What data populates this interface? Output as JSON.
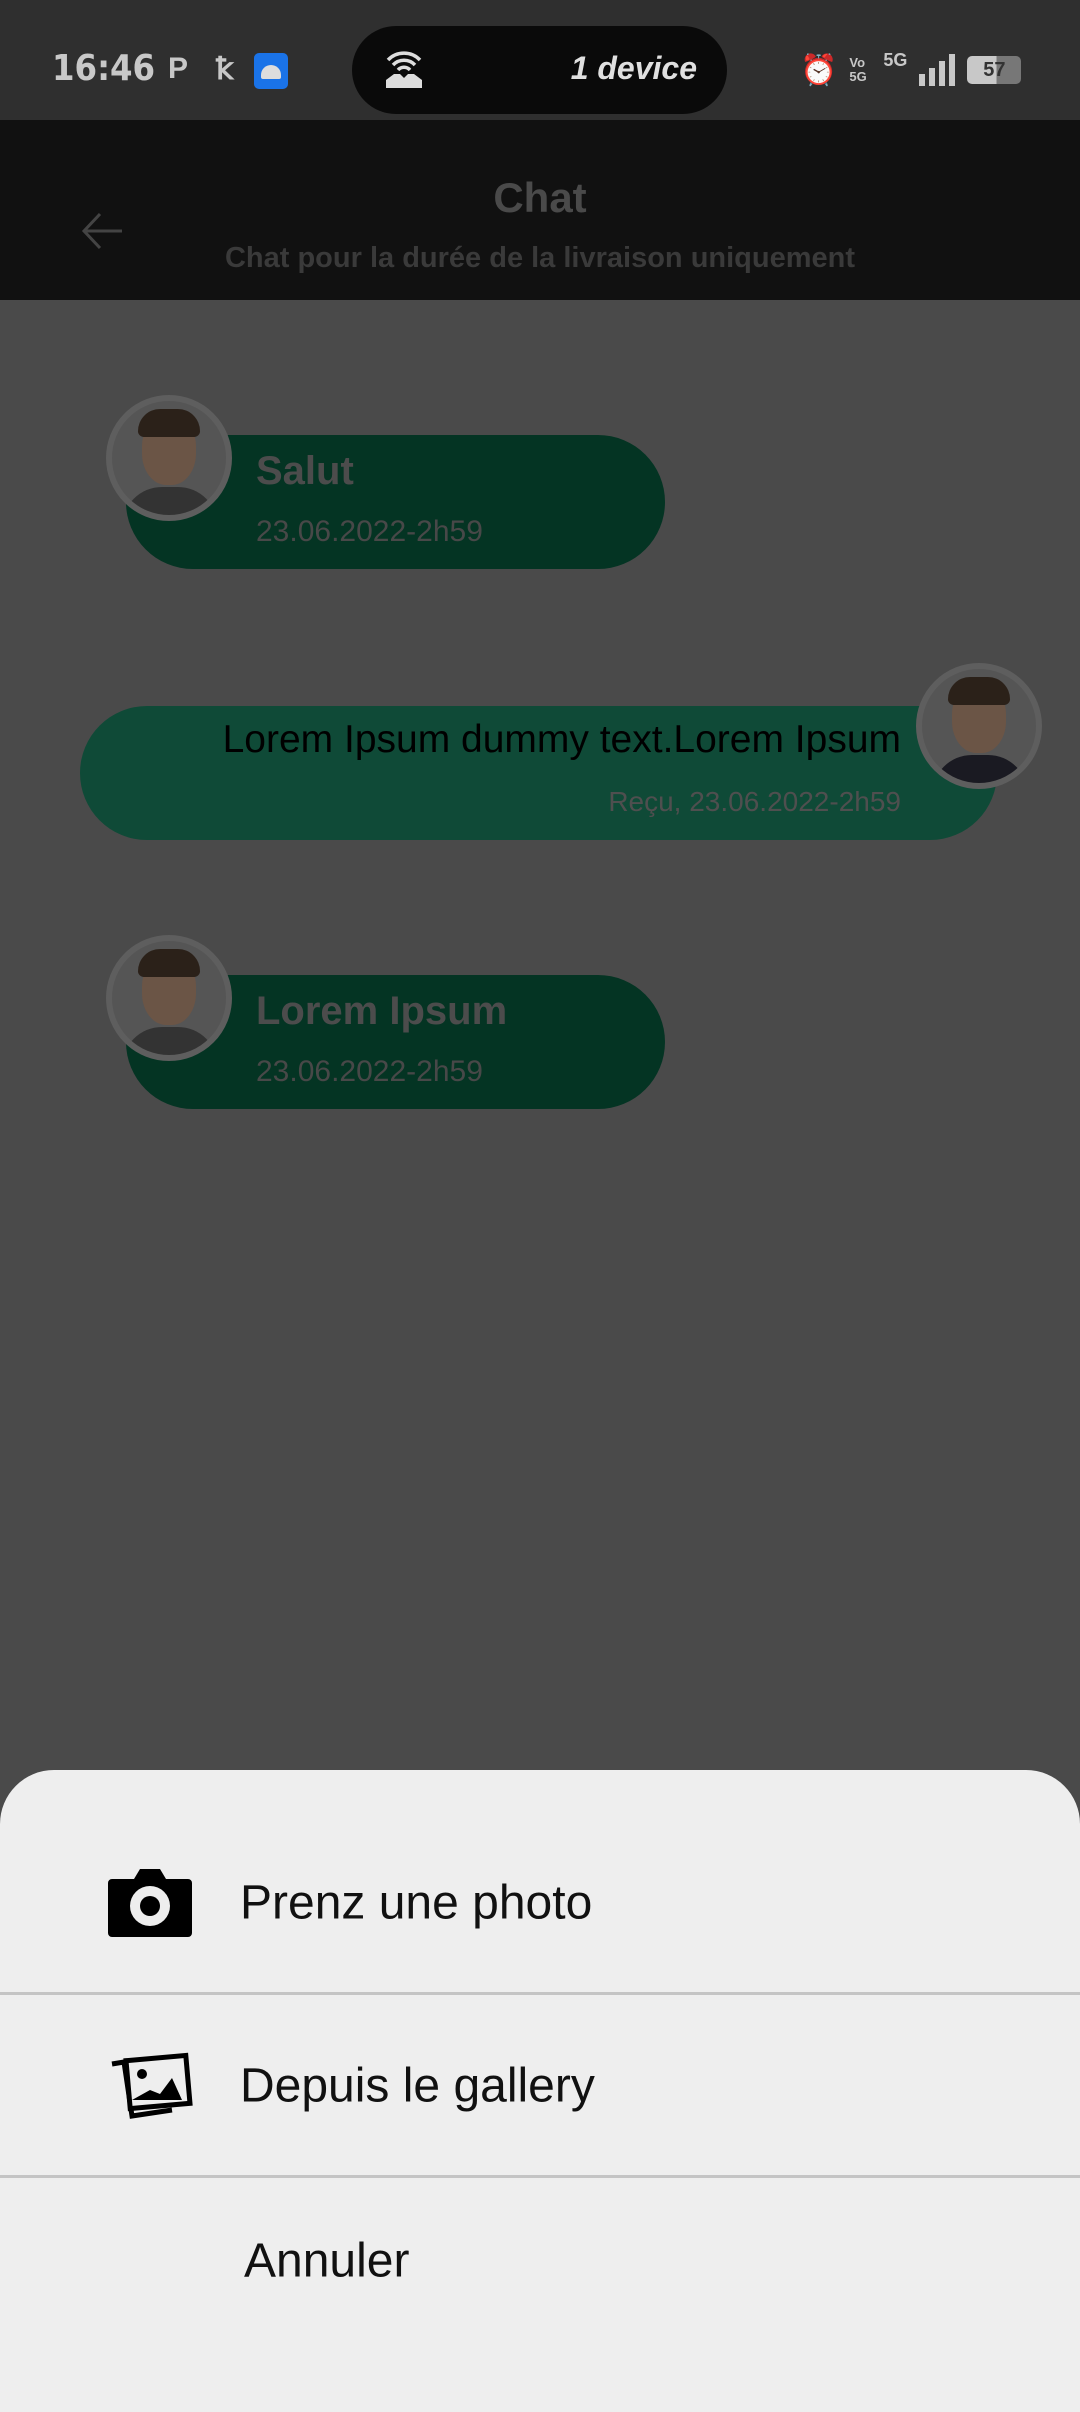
{
  "status_bar": {
    "time": "16:46",
    "p_icon": "P",
    "activity_icon": "ꝁ",
    "hotspot_label": "1 device",
    "network_vo": "Vo 5G",
    "network_type": "5G",
    "battery": "57"
  },
  "header": {
    "title": "Chat",
    "subtitle": "Chat pour la durée de la livraison uniquement"
  },
  "messages": [
    {
      "side": "left",
      "text": "Salut",
      "time": "23.06.2022-2h59"
    },
    {
      "side": "right",
      "text": "Lorem Ipsum dummy text.Lorem Ipsum",
      "time": "Reçu, 23.06.2022-2h59"
    },
    {
      "side": "left",
      "text": "Lorem Ipsum",
      "time": "23.06.2022-2h59"
    }
  ],
  "sheet": {
    "take_photo": "Prenz une photo",
    "gallery": "Depuis le gallery",
    "cancel": "Annuler"
  },
  "colors": {
    "bubble_left": "#043423",
    "bubble_right": "#0f4a37",
    "sheet_bg": "#eeeeee"
  }
}
